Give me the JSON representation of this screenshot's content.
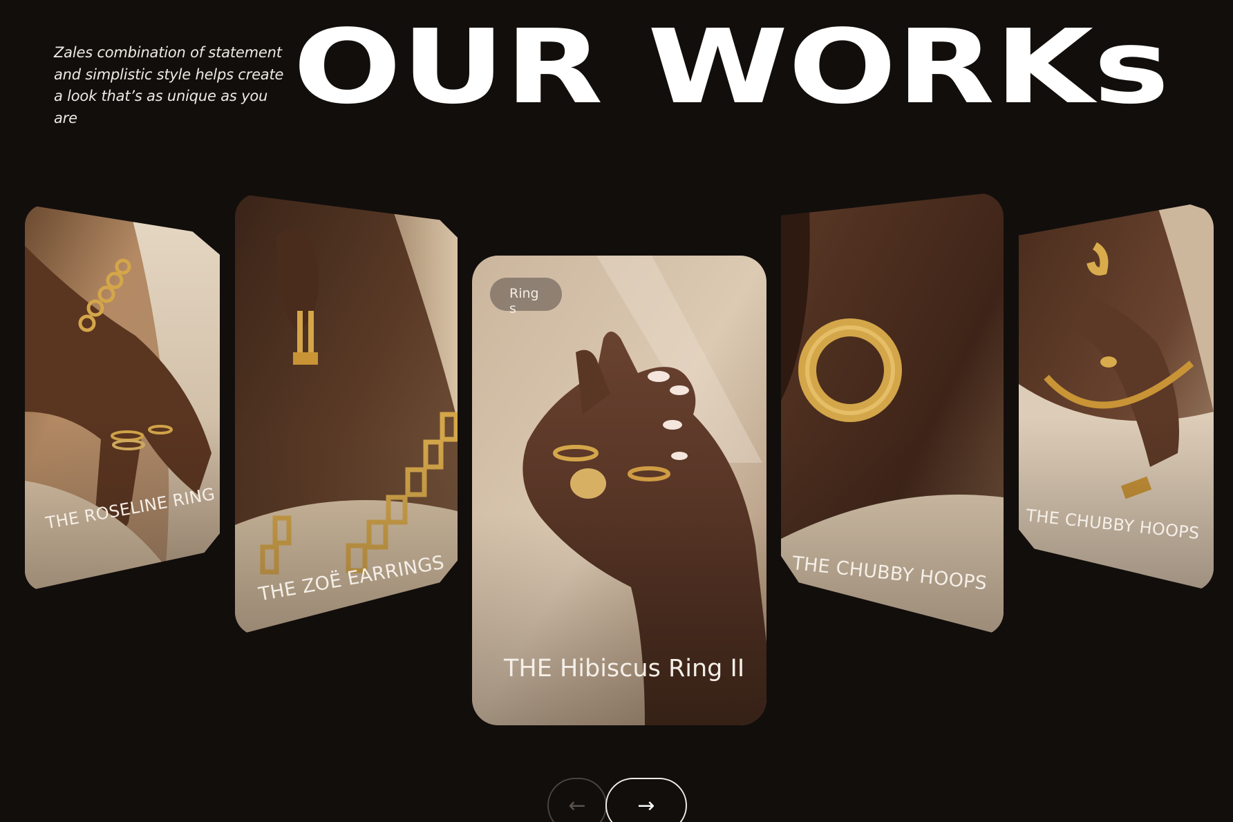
{
  "header": {
    "tagline": "Zales combination of statement and simplistic style helps create a look that’s as unique as you are",
    "headline": "OUR WORKs"
  },
  "carousel": {
    "cards": [
      {
        "title": "THE ROSELINE RING"
      },
      {
        "title": "THE ZOË EARRINGS"
      },
      {
        "title": "THE Hibiscus Ring II",
        "tag": "Rings"
      },
      {
        "title": "THE CHUBBY HOOPS"
      },
      {
        "title": "THE CHUBBY HOOPS"
      }
    ],
    "active_index": 2
  },
  "nav": {
    "prev_icon": "arrow-left-icon",
    "next_icon": "arrow-right-icon",
    "prev_glyph": "←",
    "next_glyph": "→"
  },
  "colors": {
    "background": "#120e0c",
    "text": "#ffffff",
    "tag_pill": "#786c62",
    "gold": "#c8942e"
  }
}
